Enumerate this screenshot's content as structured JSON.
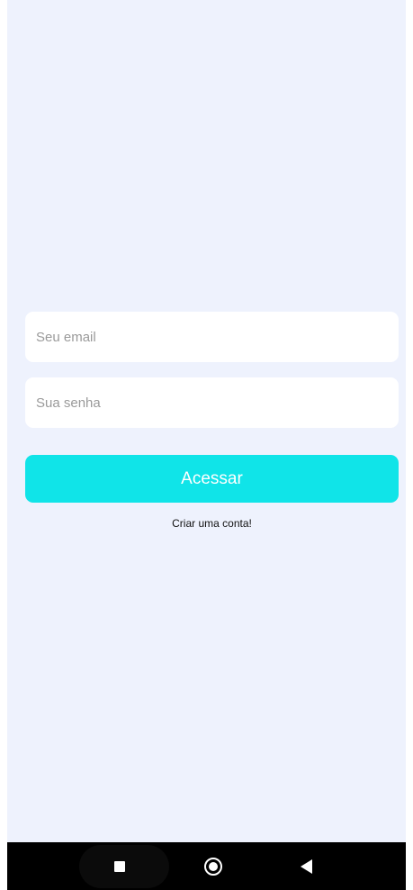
{
  "login": {
    "email_placeholder": "Seu email",
    "password_placeholder": "Sua senha",
    "submit_label": "Acessar",
    "signup_link": "Criar uma conta!"
  },
  "colors": {
    "background": "#eef2fd",
    "accent": "#10e4e8",
    "field_background": "#ffffff",
    "nav_bar": "#000000"
  },
  "system_nav": {
    "buttons": [
      {
        "icon": "square-icon",
        "action": "recent-apps"
      },
      {
        "icon": "circle-icon",
        "action": "home"
      },
      {
        "icon": "triangle-back-icon",
        "action": "back"
      }
    ]
  }
}
